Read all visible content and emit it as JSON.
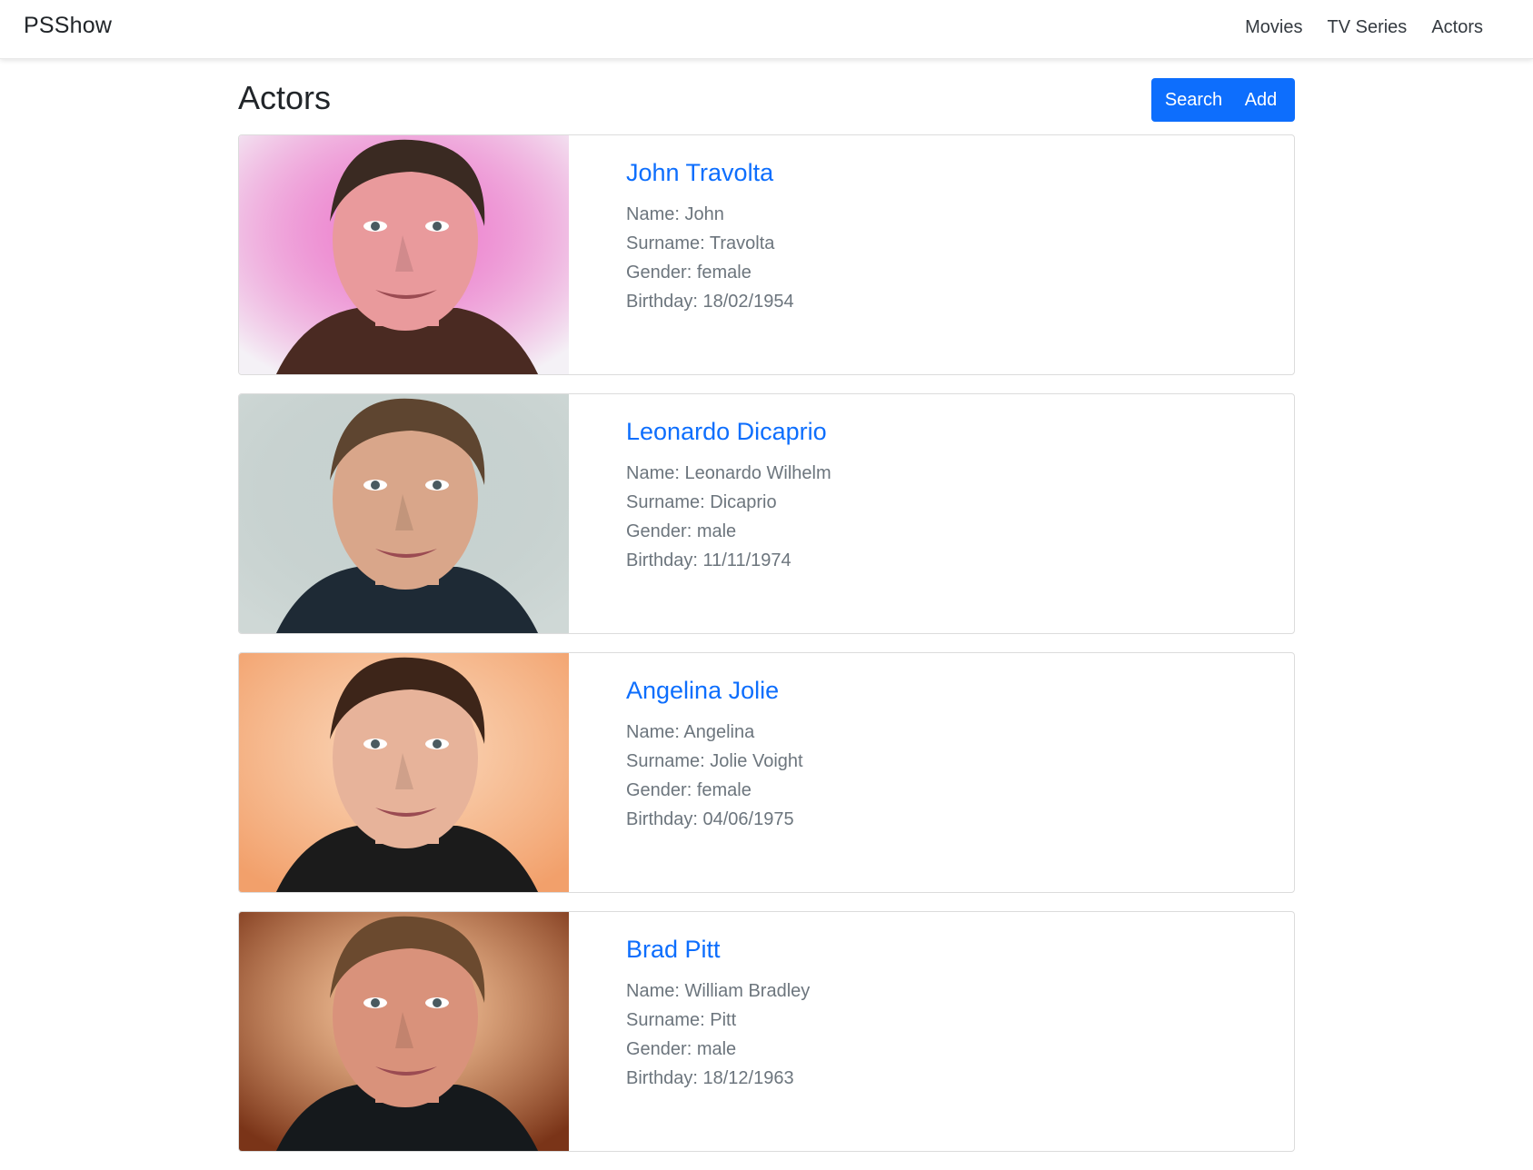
{
  "navbar": {
    "brand": "PSShow",
    "links": [
      "Movies",
      "TV Series",
      "Actors"
    ]
  },
  "page": {
    "title": "Actors",
    "search_label": "Search",
    "add_label": "Add"
  },
  "labels": {
    "name": "Name: ",
    "surname": "Surname: ",
    "gender": "Gender: ",
    "birthday": "Birthday: "
  },
  "actors": [
    {
      "full_name": "John Travolta",
      "name": "John",
      "surname": "Travolta",
      "gender": "female",
      "birthday": "18/02/1954",
      "photo": {
        "bg": "#f4f1f6",
        "skin": "#e99a9c",
        "hair": "#3a2a22",
        "shirt": "#4a2a22",
        "accent": "#e01aa6"
      }
    },
    {
      "full_name": "Leonardo Dicaprio",
      "name": "Leonardo Wilhelm",
      "surname": "Dicaprio",
      "gender": "male",
      "birthday": "11/11/1974",
      "photo": {
        "bg": "#cfd8d6",
        "skin": "#d9a68a",
        "hair": "#5e4530",
        "shirt": "#1e2a35",
        "accent": "#9fb1ae"
      }
    },
    {
      "full_name": "Angelina Jolie",
      "name": "Angelina",
      "surname": "Jolie Voight",
      "gender": "female",
      "birthday": "04/06/1975",
      "photo": {
        "bg": "#f2a06b",
        "skin": "#e7b39a",
        "hair": "#3d2519",
        "shirt": "#1b1b1b",
        "accent": "#f6b784"
      }
    },
    {
      "full_name": "Brad Pitt",
      "name": "William Bradley",
      "surname": "Pitt",
      "gender": "male",
      "birthday": "18/12/1963",
      "photo": {
        "bg": "#7a3418",
        "skin": "#d9927b",
        "hair": "#6b4a2f",
        "shirt": "#15191c",
        "accent": "#f2a05a"
      }
    }
  ]
}
